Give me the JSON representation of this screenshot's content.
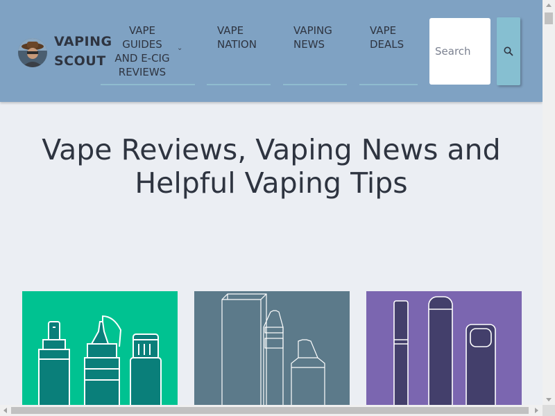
{
  "header": {
    "brand_line1": "VAPING",
    "brand_line2": "SCOUT",
    "nav": [
      {
        "lines": [
          "VAPE",
          "GUIDES",
          "AND E-CIG",
          "REVIEWS"
        ],
        "has_dropdown": true
      },
      {
        "lines": [
          "VAPE",
          "NATION"
        ]
      },
      {
        "lines": [
          "VAPING",
          "NEWS"
        ]
      },
      {
        "lines": [
          "VAPE",
          "DEALS"
        ]
      }
    ],
    "search_placeholder": "Search",
    "search_icon": "search-icon",
    "dropdown_icon": "chevron-down-icon"
  },
  "hero": {
    "line1": "Vape Reviews, Vaping News and",
    "line2": "Helpful Vaping Tips"
  },
  "cards": [
    {
      "name": "e-liquid-bottles-card",
      "color": "#00c291"
    },
    {
      "name": "vape-product-outlines-card",
      "color": "#5c7a8a"
    },
    {
      "name": "e-cig-devices-card",
      "color": "#7b66b0"
    }
  ],
  "colors": {
    "header_bg": "#7fa2c3",
    "page_bg": "#ebeef3",
    "search_button": "#86bfd1",
    "nav_underline": "#8fbccf",
    "text": "#2e3440"
  }
}
